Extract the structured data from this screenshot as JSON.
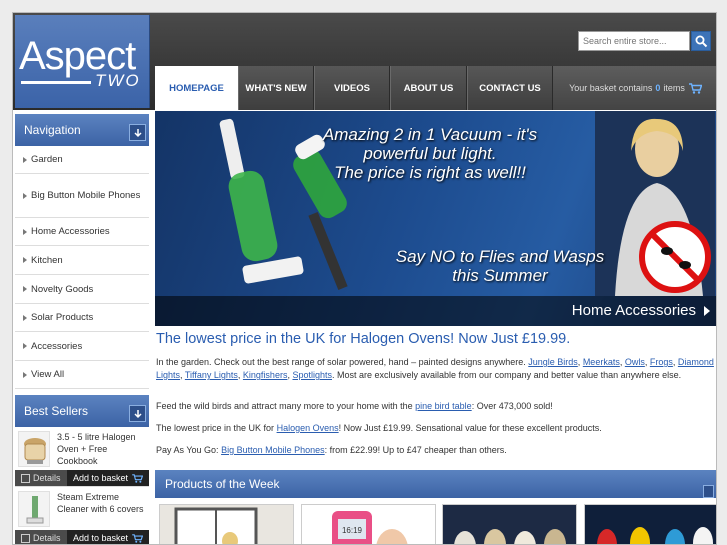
{
  "logo": {
    "main": "Aspect",
    "sub": "TWO"
  },
  "search": {
    "placeholder": "Search entire store..."
  },
  "nav": [
    {
      "label": "HOMEPAGE",
      "active": true
    },
    {
      "label": "WHAT'S NEW"
    },
    {
      "label": "VIDEOS"
    },
    {
      "label": "ABOUT US"
    },
    {
      "label": "CONTACT US"
    }
  ],
  "basket": {
    "prefix": "Your basket contains",
    "count": "0",
    "suffix": "items"
  },
  "sidebar": {
    "nav_title": "Navigation",
    "items": [
      "Garden",
      "Big Button Mobile Phones",
      "Home Accessories",
      "Kitchen",
      "Novelty Goods",
      "Solar Products",
      "Accessories",
      "View All"
    ],
    "best_title": "Best Sellers",
    "best": [
      {
        "name": "3.5 - 5 litre Halogen Oven + Free Cookbook",
        "details": "Details",
        "add": "Add to basket"
      },
      {
        "name": "Steam Extreme Cleaner with 6 covers",
        "details": "Details",
        "add": "Add to basket"
      }
    ]
  },
  "banner": {
    "line1": "Amazing 2 in 1 Vacuum - it's powerful but light.",
    "line2": "The price is right as well!!",
    "line3": "Say NO to Flies and Wasps this Summer",
    "footer": "Home Accessories"
  },
  "content": {
    "headline": "The lowest price in the UK for Halogen Ovens! Now Just £19.99.",
    "p1_pre": "In the garden. Check out the best range of solar powered, hand – painted designs anywhere.",
    "p1_links": [
      "Jungle Birds",
      "Meerkats",
      "Owls",
      "Frogs",
      "Diamond Lights",
      "Tiffany Lights",
      "Kingfishers",
      "Spotlights"
    ],
    "p1_post": ". Most are exclusively available from our company and better value than anywhere else.",
    "p2_pre": "Feed the wild birds and attract many more to your home with the",
    "p2_link": "pine bird table",
    "p2_post": ": Over 473,000 sold!",
    "p3_pre": "The lowest price in the UK for",
    "p3_link": "Halogen Ovens",
    "p3_post": "! Now Just £19.99. Sensational value for these excellent products.",
    "p4_pre": "Pay As You Go:",
    "p4_link": "Big Button Mobile Phones",
    "p4_post": ": from £22.99! Up to £47 cheaper than others."
  },
  "products_title": "Products of the Week",
  "phone_screen": "16:19",
  "colors": {
    "accent": "#2a5db0",
    "nav_dark": "#3e3e3e",
    "panel_blue": "#3c63a5"
  }
}
